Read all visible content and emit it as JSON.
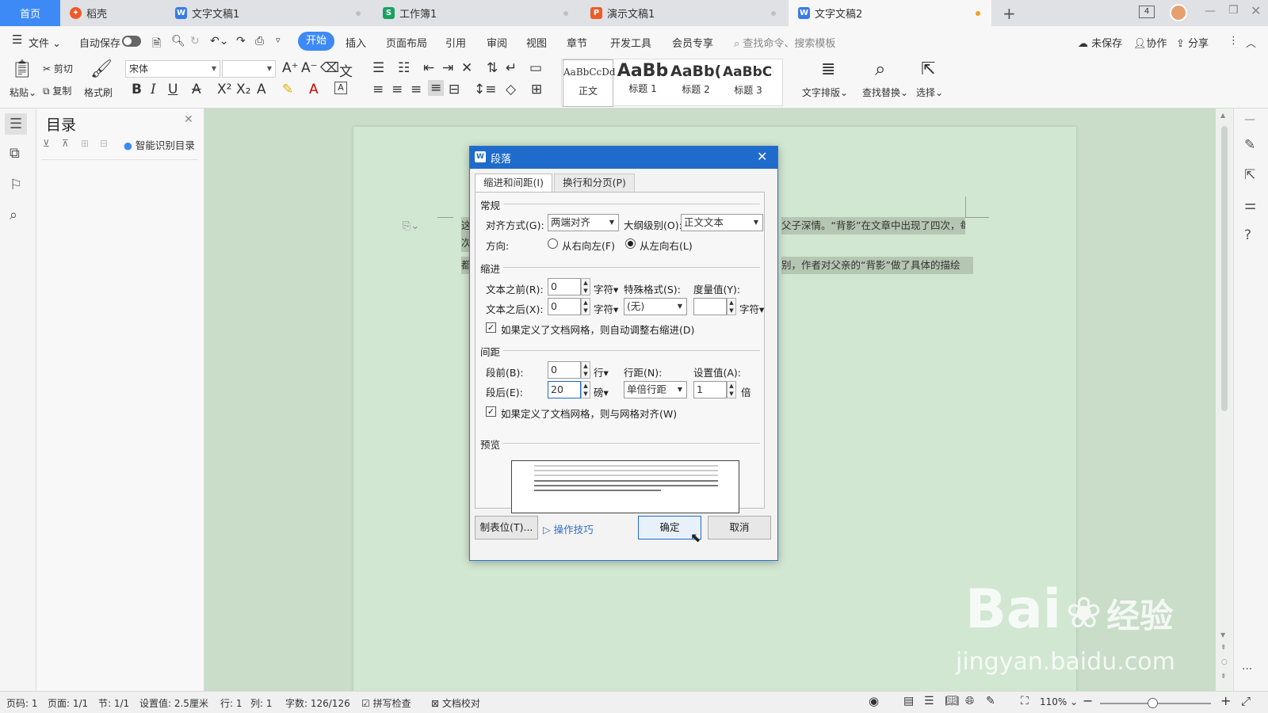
{
  "tabs": [
    {
      "label": "首页",
      "icon": ""
    },
    {
      "label": "稻壳",
      "icon": "daoke-icon"
    },
    {
      "label": "文字文稿1",
      "icon": "W"
    },
    {
      "label": "工作簿1",
      "icon": "S"
    },
    {
      "label": "演示文稿1",
      "icon": "P"
    },
    {
      "label": "文字文稿2",
      "icon": "W"
    }
  ],
  "tabbar": {
    "page_badge": "4"
  },
  "menu": {
    "file": "文件",
    "autosave": "自动保存",
    "items": [
      "开始",
      "插入",
      "页面布局",
      "引用",
      "审阅",
      "视图",
      "章节",
      "开发工具",
      "会员专享"
    ],
    "search_placeholder": "查找命令、搜索模板",
    "unsaved": "未保存",
    "collab": "协作",
    "share": "分享"
  },
  "ribbon": {
    "paste": "粘贴",
    "cut": "剪切",
    "copy": "复制",
    "format_painter": "格式刷",
    "font": "宋体",
    "font_size": "",
    "styles": [
      {
        "preview": "AaBbCcDd",
        "label": "正文"
      },
      {
        "preview": "AaBb",
        "label": "标题 1"
      },
      {
        "preview": "AaBb(",
        "label": "标题 2"
      },
      {
        "preview": "AaBbC(",
        "label": "标题 3"
      }
    ],
    "text_layout": "文字排版",
    "find_replace": "查找替换",
    "select": "选择"
  },
  "nav": {
    "title": "目录",
    "smart_toc": "智能识别目录"
  },
  "document": {
    "line1_start": "这",
    "line1_end": "父子深情。“背影”在文章中出现了四次，每",
    "line1b": "次",
    "line2_start": "都",
    "line2_end": "别，作者对父亲的“背影”做了具体的描绘"
  },
  "dialog": {
    "title": "段落",
    "tabs": [
      "缩进和间距(I)",
      "换行和分页(P)"
    ],
    "general": "常规",
    "align_label": "对齐方式(G):",
    "align_value": "两端对齐",
    "outline_label": "大纲级别(O):",
    "outline_value": "正文文本",
    "direction_label": "方向:",
    "rtl": "从右向左(F)",
    "ltr": "从左向右(L)",
    "indent": "缩进",
    "before_text_label": "文本之前(R):",
    "before_text_value": "0",
    "unit_char": "字符",
    "special_label": "特殊格式(S):",
    "measure_label": "度量值(Y):",
    "after_text_label": "文本之后(X):",
    "after_text_value": "0",
    "special_value": "(无)",
    "measure_value": "",
    "grid_indent": "如果定义了文档网格，则自动调整右缩进(D)",
    "spacing": "间距",
    "before_label": "段前(B):",
    "before_value": "0",
    "before_unit": "行",
    "line_label": "行距(N):",
    "setting_label": "设置值(A):",
    "after_label": "段后(E):",
    "after_value": "20",
    "after_unit": "磅",
    "line_value": "单倍行距",
    "setting_value": "1",
    "setting_unit": "倍",
    "grid_align": "如果定义了文档网格，则与网格对齐(W)",
    "preview": "预览",
    "tabstops": "制表位(T)...",
    "tips": "操作技巧",
    "ok": "确定",
    "cancel": "取消"
  },
  "status": {
    "page_code": "页码: 1",
    "page": "页面: 1/1",
    "section": "节: 1/1",
    "setting": "设置值: 2.5厘米",
    "row": "行: 1",
    "col": "列: 1",
    "words": "字数: 126/126",
    "spell": "拼写检查",
    "proof": "文档校对",
    "zoom": "110%"
  },
  "watermark": {
    "brand": "Bai",
    "brand2": "经验",
    "url": "jingyan.baidu.com"
  },
  "colors": {
    "accent": "#1f6bcc",
    "tab_active": "#f7f7f7",
    "home_tab": "#3d8af7",
    "doc_bg": "#c9ddc9"
  }
}
